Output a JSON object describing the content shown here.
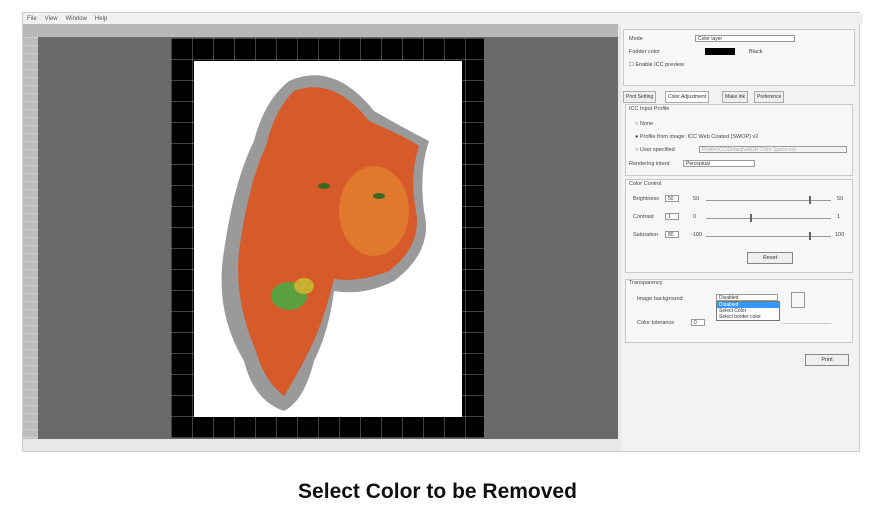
{
  "menu": [
    "File",
    "View",
    "Window",
    "Help"
  ],
  "panel": {
    "mode_label": "Mode",
    "mode_value": "Color layer",
    "fodder_label": "Fodder color",
    "fodder_value": "Black",
    "icc_preview": "Enable ICC preview",
    "tabs": [
      "Print Setting",
      "Color Adjustment",
      "Make ink",
      "Preference"
    ],
    "icc": {
      "title": "ICC Input Profile",
      "none": "None",
      "from_image": "Profile from image:",
      "from_image_value": "ICC Web Coated (SWOP) v2",
      "user": "User specified",
      "user_value": "Profile\\ICC\\Default\\sRGB Color Space.icm",
      "intent_label": "Rendering intent",
      "intent_value": "Perceptual"
    },
    "color_control": {
      "title": "Color Control",
      "brightness": {
        "label": "Brightness",
        "value": "50",
        "min": "50",
        "max": "50",
        "fraction": 0.82
      },
      "contrast": {
        "label": "Contrast",
        "value": "1",
        "min": "0",
        "max": "1",
        "fraction": 0.35
      },
      "saturation": {
        "label": "Saturation",
        "value": "80",
        "min": "-100",
        "max": "100",
        "fraction": 0.82
      },
      "reset": "Reset"
    },
    "transparency": {
      "title": "Transparency",
      "bg_label": "Image background",
      "bg_value": "Disabled",
      "options": [
        "Disabled",
        "Select Color",
        "Select border color"
      ],
      "tolerance_label": "Color tolerance",
      "tolerance_value": "0"
    },
    "print": "Print"
  },
  "caption": "Select Color to be Removed",
  "colors": {
    "accent": "#3399ff"
  }
}
